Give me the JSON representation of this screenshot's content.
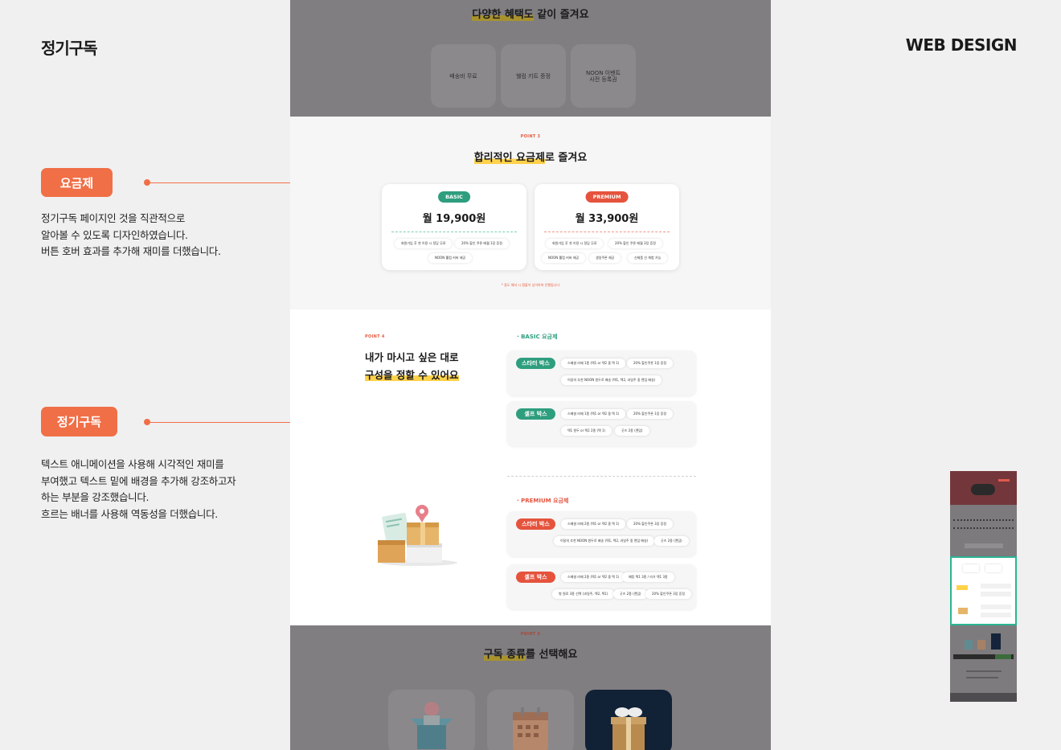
{
  "header": {
    "title": "정기구독",
    "brand": "WEB DESIGN"
  },
  "annotations": [
    {
      "tag": "요금제",
      "lines": [
        "정기구독 페이지인 것을 직관적으로",
        "알아볼 수 있도록 디자인하였습니다.",
        "버튼 호버 효과를 추가해 재미를 더했습니다."
      ]
    },
    {
      "tag": "정기구독",
      "lines": [
        "텍스트 애니메이션을 사용해 시각적인 재미를",
        "부여했고 텍스트 밑에 배경을 추가해 강조하고자",
        "하는 부분을 강조했습니다.",
        "흐르는 배너를 사용해 역동성을 더했습니다."
      ]
    }
  ],
  "benefits": {
    "title_highlight": "다양한 혜택도",
    "title_rest": " 같이 즐겨요",
    "items": [
      [
        "배송비 무료"
      ],
      [
        "웰컴 키트 증정"
      ],
      [
        "NOON 이벤트",
        "사전 등록권"
      ]
    ]
  },
  "pricing": {
    "point": "POINT 3",
    "title_highlight": "합리적인 요금제",
    "title_rest": "로 즐겨요",
    "plans": [
      {
        "badge": "BASIC",
        "price": "월 19,900원",
        "color": "#2e9e7e",
        "features": [
          "회원가입 후 첫 이용 시 정담 무료",
          "20% 할인 쿠폰 매월 1장 증정",
          "NOON 웰컴 커버 제공"
        ]
      },
      {
        "badge": "PREMIUM",
        "price": "월 33,900원",
        "color": "#e5533d",
        "features": [
          "회원가입 후 첫 이용 시 정담 무료",
          "20% 할인 쿠폰 매월 3장 증정",
          "NOON 웰컴 커버 제공",
          "생일쿠폰 제공",
          "신제품 선 체험 가능"
        ]
      }
    ],
    "note": "* 중도 해지 시 환불이 상이하여 진행됩니다"
  },
  "compose": {
    "point": "POINT 4",
    "title_line1": "내가 마시고 싶은 대로",
    "title_line2": "구성을 정할 수 있어요",
    "basic_label": "· BASIC 요금제",
    "premium_label": "· PREMIUM 요금제",
    "basic_boxes": [
      {
        "name": "스타터 박스",
        "chips": [
          "스페셜 라떼 1종 (택1 or 택2 중 택 1)",
          "20% 할인쿠폰 1장 증정",
          "이달의 추천 NOON 원두로 배송 (택1, 택2, 과일주 중 랜덤 배송)"
        ]
      },
      {
        "name": "셀프 박스",
        "chips": [
          "스페셜 라떼 1종 (택1 or 택2 중 택 1)",
          "20% 할인쿠폰 1장 증정",
          "택1 원두 or 택2 2종 (택 1)",
          "굿즈 2종 (랜덤)"
        ]
      }
    ],
    "premium_boxes": [
      {
        "name": "스타터 박스",
        "chips": [
          "스페셜 라떼 2종 (택1 or 택2 중 택 1)",
          "20% 할인쿠폰 3장 증정",
          "이달의 추천 NOON 원두로 배송 (택1, 택2, 과일주 중 랜덤 배송)",
          "굿즈 2종 (랜덤)"
        ]
      },
      {
        "name": "셀프 박스",
        "chips": [
          "스페셜 라떼 2종 (택1 or 택2 중 택 1)",
          "패킹 택1 3종 / 라거 택1 3종",
          "병 원료 3종 선택 (과일주, 택2, 택1)",
          "굿즈 2종 (랜덤)",
          "20% 할인쿠폰 3장 증정"
        ]
      }
    ]
  },
  "subscription_type": {
    "point": "POINT 5",
    "title_highlight": "구독 종류",
    "title_rest": "를 선택해요"
  },
  "colors": {
    "accent": "#f06f47",
    "basic": "#2e9e7e",
    "premium": "#e5533d",
    "highlight": "#ffd24a",
    "overlay": "#807e81"
  }
}
